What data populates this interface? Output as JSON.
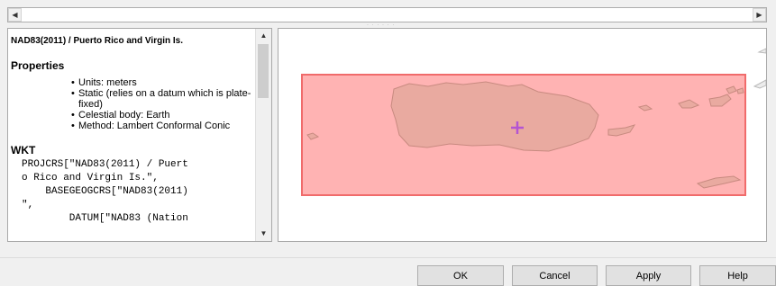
{
  "crs": {
    "title": "NAD83(2011) / Puerto Rico and Virgin Is.",
    "properties_heading": "Properties",
    "properties": [
      "Units: meters",
      "Static (relies on a datum which is plate-fixed)",
      "Celestial body: Earth",
      "Method: Lambert Conformal Conic"
    ],
    "wkt_heading": "WKT",
    "wkt_lines": [
      "PROJCRS[\"NAD83(2011) / Puert",
      "o Rico and Virgin Is.\",",
      "    BASEGEOGCRS[\"NAD83(2011)",
      "\",",
      "        DATUM[\"NAD83 (Nation"
    ]
  },
  "map": {
    "extent_fill": "#ffb3b3",
    "extent_stroke": "#f06b6b",
    "land_fill": "#e9aaa0",
    "land_stroke": "#c88a80",
    "center_marker_color": "#b455d2"
  },
  "scrollbar": {
    "left_arrow": "◀",
    "right_arrow": "▶",
    "up_arrow": "▲",
    "down_arrow": "▼"
  },
  "buttons": {
    "ok": "OK",
    "cancel": "Cancel",
    "apply": "Apply",
    "help": "Help"
  }
}
